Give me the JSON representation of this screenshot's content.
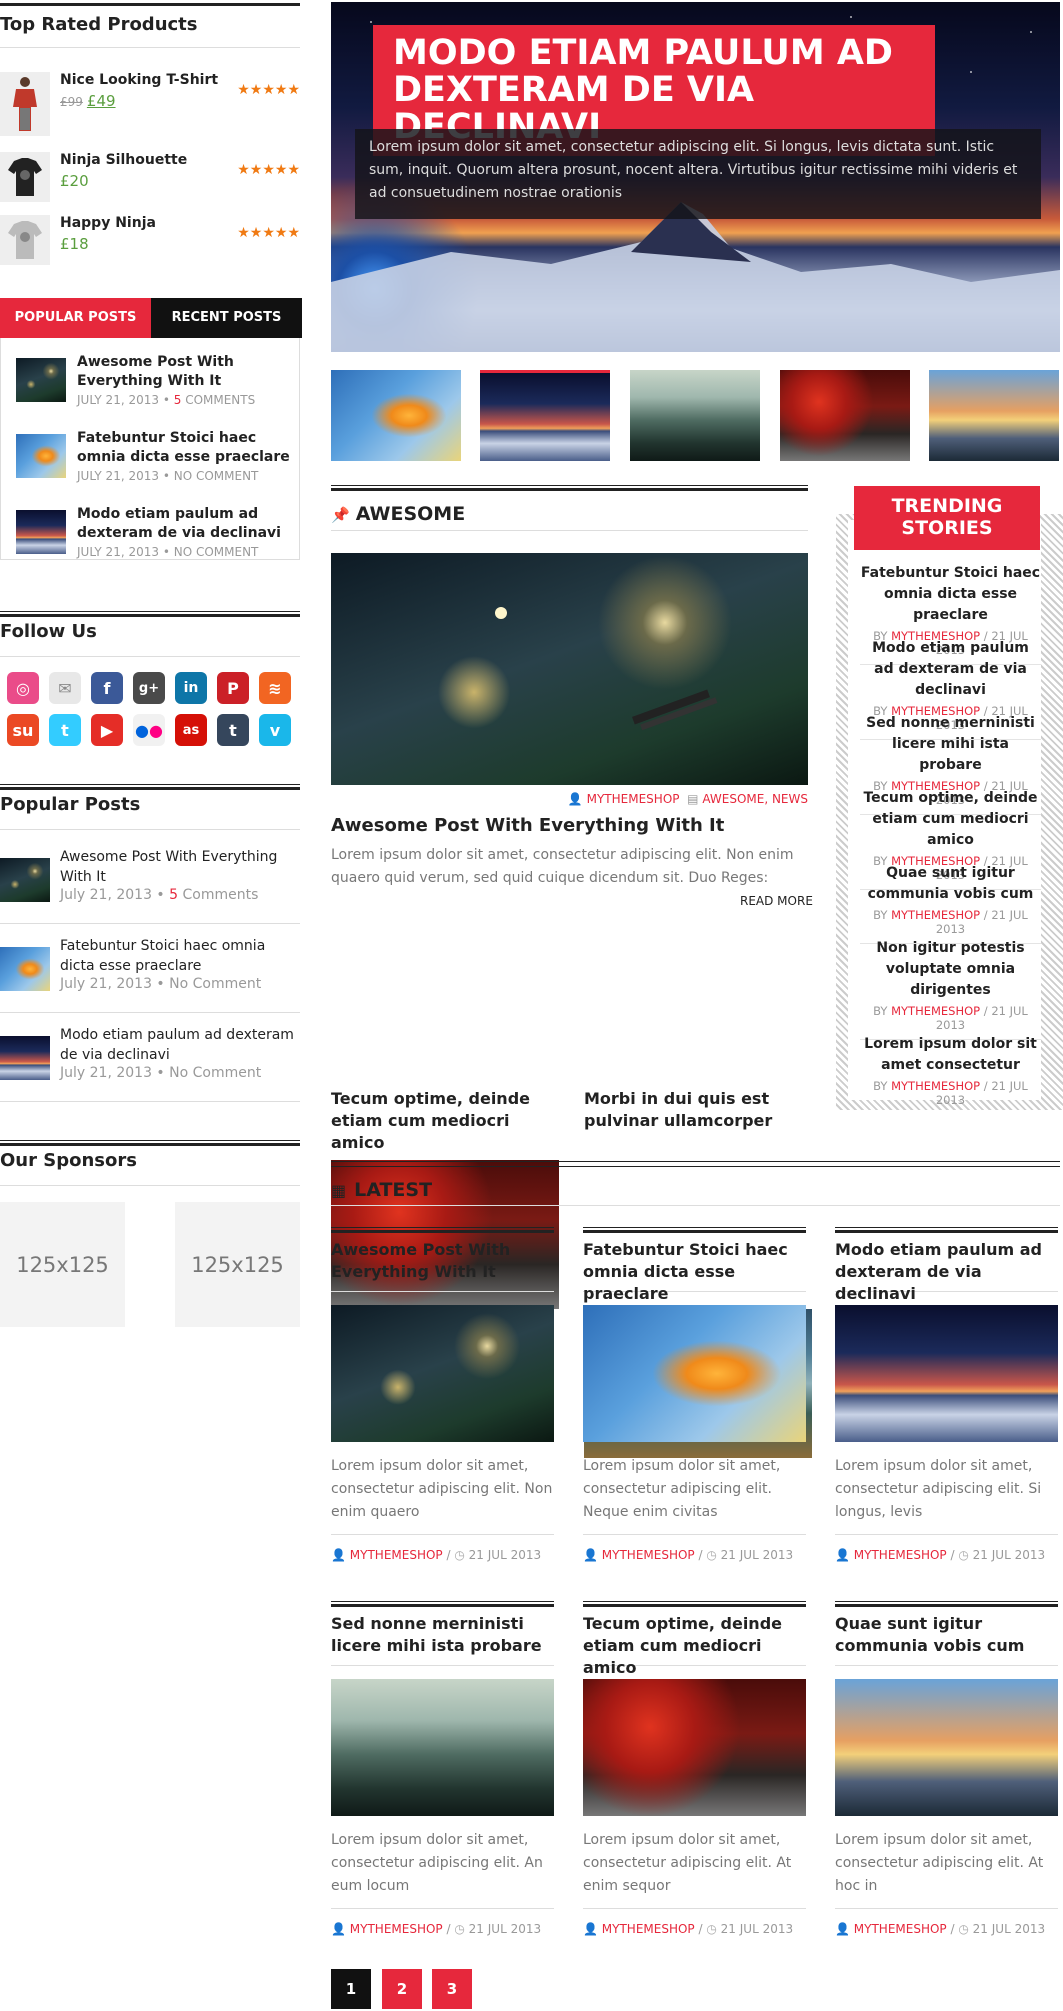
{
  "sidebar": {
    "top_rated": {
      "title": "Top Rated Products",
      "products": [
        {
          "name": "Nice Looking T-Shirt",
          "old_price": "£99",
          "price": "£49",
          "rating": 5
        },
        {
          "name": "Ninja Silhouette",
          "price": "£20",
          "rating": 5
        },
        {
          "name": "Happy Ninja",
          "price": "£18",
          "rating": 5
        }
      ],
      "stars": "★★★★★"
    },
    "tabs": {
      "popular_label": "POPULAR POSTS",
      "recent_label": "RECENT POSTS",
      "posts": [
        {
          "title": "Awesome Post With Everything With It",
          "date": "JULY 21, 2013",
          "count": "5",
          "comments": "COMMENTS"
        },
        {
          "title": "Fatebuntur Stoici haec omnia dicta esse praeclare",
          "date": "JULY 21, 2013",
          "comments": "NO COMMENT"
        },
        {
          "title": "Modo etiam paulum ad dexteram de via declinavi",
          "date": "JULY 21, 2013",
          "comments": "NO COMMENT"
        }
      ]
    },
    "follow": {
      "title": "Follow Us",
      "icons": [
        "dribbble-icon",
        "email-icon",
        "facebook-icon",
        "google-plus-icon",
        "linkedin-icon",
        "pinterest-icon",
        "rss-icon",
        "stumbleupon-icon",
        "twitter-icon",
        "youtube-icon",
        "flickr-icon",
        "lastfm-icon",
        "tumblr-icon",
        "vimeo-icon"
      ]
    },
    "popular": {
      "title": "Popular Posts",
      "posts": [
        {
          "title": "Awesome Post With Everything With It",
          "date": "July 21, 2013",
          "count": "5",
          "comments": "Comments"
        },
        {
          "title": "Fatebuntur Stoici haec omnia dicta esse praeclare",
          "date": "July 21, 2013",
          "comments": "No Comment"
        },
        {
          "title": "Modo etiam paulum ad dexteram de via declinavi",
          "date": "July 21, 2013",
          "comments": "No Comment"
        }
      ]
    },
    "sponsors": {
      "title": "Our Sponsors",
      "items": [
        "125x125",
        "125x125"
      ]
    }
  },
  "hero": {
    "title": "MODO ETIAM PAULUM AD DEXTERAM DE VIA DECLINAVI",
    "desc": "Lorem ipsum dolor sit amet, consectetur adipiscing elit. Si longus, levis dictata sunt. Istic sum, inquit. Quorum altera prosunt, nocent altera. Virtutibus igitur rectissime mihi videris et ad consuetudinem nostrae orationis"
  },
  "awesome": {
    "title": "AWESOME",
    "feature": {
      "author": "MYTHEMESHOP",
      "categories": "AWESOME, NEWS",
      "title": "Awesome Post With Everything With It",
      "excerpt": "Lorem ipsum dolor sit amet, consectetur adipiscing elit. Non enim quaero quid verum, sed quid cuique dicendum sit. Duo Reges:",
      "read_more": "READ MORE"
    },
    "small": [
      {
        "title": "Tecum optime, deinde etiam cum mediocri amico"
      },
      {
        "title": "Morbi in dui quis est pulvinar ullamcorper"
      }
    ]
  },
  "trending": {
    "title": "TRENDING STORIES",
    "by": "BY",
    "items": [
      {
        "title": "Fatebuntur Stoici haec omnia dicta esse praeclare",
        "author": "MYTHEMESHOP",
        "date": "21 JUL 2013"
      },
      {
        "title": "Modo etiam paulum ad dexteram de via declinavi",
        "author": "MYTHEMESHOP",
        "date": "21 JUL 2013"
      },
      {
        "title": "Sed nonne merninisti licere mihi ista probare",
        "author": "MYTHEMESHOP",
        "date": "21 JUL 2013"
      },
      {
        "title": "Tecum optime, deinde etiam cum mediocri amico",
        "author": "MYTHEMESHOP",
        "date": "21 JUL 2013"
      },
      {
        "title": "Quae sunt igitur communia vobis cum",
        "author": "MYTHEMESHOP",
        "date": "21 JUL 2013"
      },
      {
        "title": "Non igitur potestis voluptate omnia dirigentes",
        "author": "MYTHEMESHOP",
        "date": "21 JUL 2013"
      },
      {
        "title": "Lorem ipsum dolor sit amet consectetur",
        "author": "MYTHEMESHOP",
        "date": "21 JUL 2013"
      }
    ]
  },
  "latest": {
    "title": "LATEST",
    "posts": [
      {
        "title": "Awesome Post With Everything With It",
        "excerpt": "Lorem ipsum dolor sit amet, consectetur adipiscing elit. Non enim quaero",
        "author": "MYTHEMESHOP",
        "date": "21 JUL 2013"
      },
      {
        "title": "Fatebuntur Stoici haec omnia dicta esse praeclare",
        "excerpt": "Lorem ipsum dolor sit amet, consectetur adipiscing elit. Neque enim civitas",
        "author": "MYTHEMESHOP",
        "date": "21 JUL 2013"
      },
      {
        "title": "Modo etiam paulum ad dexteram de via declinavi",
        "excerpt": "Lorem ipsum dolor sit amet, consectetur adipiscing elit. Si longus, levis",
        "author": "MYTHEMESHOP",
        "date": "21 JUL 2013"
      },
      {
        "title": "Sed nonne merninisti licere mihi ista probare",
        "excerpt": "Lorem ipsum dolor sit amet, consectetur adipiscing elit. An eum locum",
        "author": "MYTHEMESHOP",
        "date": "21 JUL 2013"
      },
      {
        "title": "Tecum optime, deinde etiam cum mediocri amico",
        "excerpt": "Lorem ipsum dolor sit amet, consectetur adipiscing elit. At enim sequor",
        "author": "MYTHEMESHOP",
        "date": "21 JUL 2013"
      },
      {
        "title": "Quae sunt igitur communia vobis cum",
        "excerpt": "Lorem ipsum dolor sit amet, consectetur adipiscing elit. At hoc in",
        "author": "MYTHEMESHOP",
        "date": "21 JUL 2013"
      }
    ]
  },
  "pagination": {
    "pages": [
      "1",
      "2",
      "3"
    ],
    "current": "1"
  },
  "colors": {
    "accent": "#e6283c",
    "dark": "#111111",
    "price": "#5a9e3e",
    "star": "#f07a13"
  }
}
